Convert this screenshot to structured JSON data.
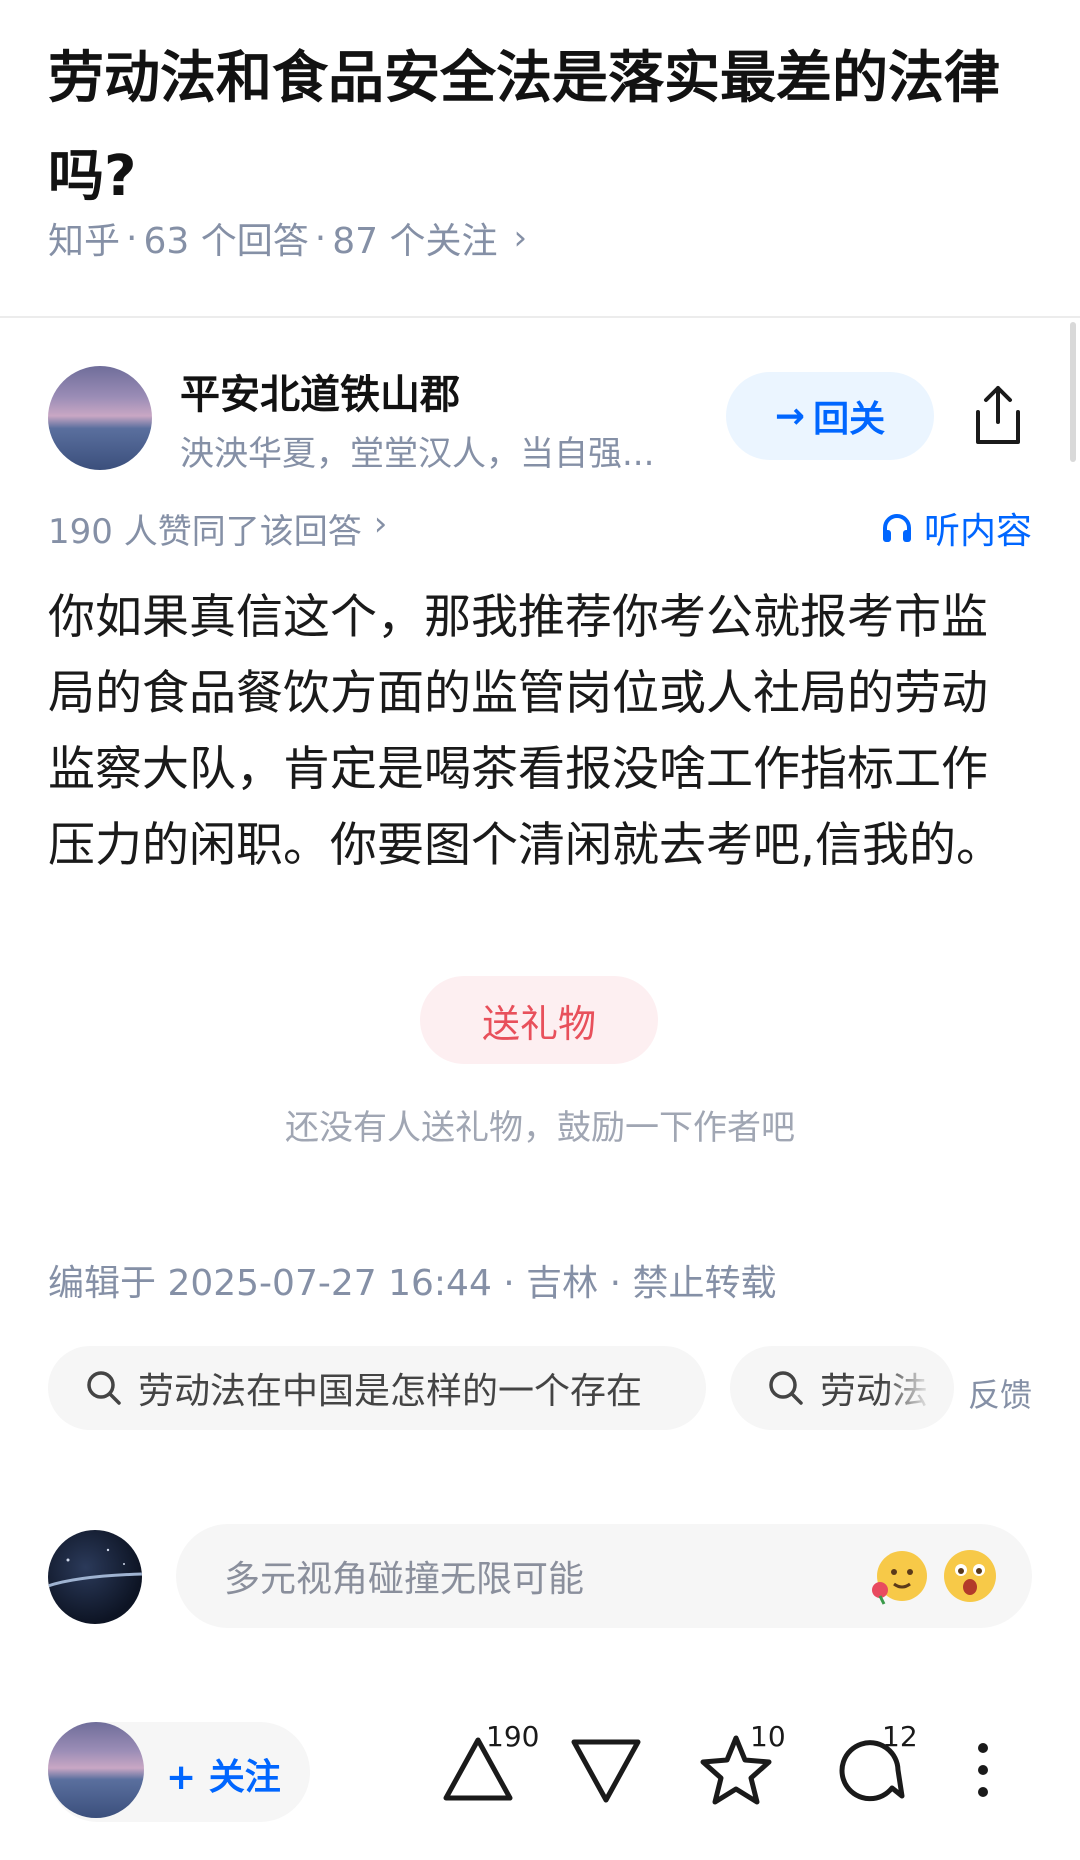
{
  "question": {
    "title": "劳动法和食品安全法是落实最差的法律吗?",
    "source": "知乎",
    "answers": "63 个回答",
    "followers": "87 个关注",
    "sep": "·"
  },
  "author": {
    "name": "平安北道铁山郡",
    "bio": "泱泱华夏，堂堂汉人，当自强...",
    "follow_back_label": "回关",
    "follow_back_arrow": "→"
  },
  "answer": {
    "agree_text": "190 人赞同了该回答",
    "listen_label": "听内容",
    "content": "你如果真信这个，那我推荐你考公就报考市监局的食品餐饮方面的监管岗位或人社局的劳动监察大队，肯定是喝茶看报没啥工作指标工作压力的闲职。你要图个清闲就去考吧,信我的。",
    "gift_label": "送礼物",
    "gift_hint": "还没有人送礼物，鼓励一下作者吧",
    "edit_info": "编辑于 2025-07-27 16:44 · 吉林 · 禁止转载"
  },
  "related_searches": [
    "劳动法在中国是怎样的一个存在",
    "劳动法"
  ],
  "feedback_label": "反馈",
  "comment": {
    "placeholder": "多元视角碰撞无限可能"
  },
  "bottom_bar": {
    "follow_label": "+ 关注",
    "upvotes": "190",
    "favorites": "10",
    "comments": "12"
  },
  "colors": {
    "accent": "#0066ff",
    "muted": "#8590a6",
    "gift": "#e8505b"
  }
}
